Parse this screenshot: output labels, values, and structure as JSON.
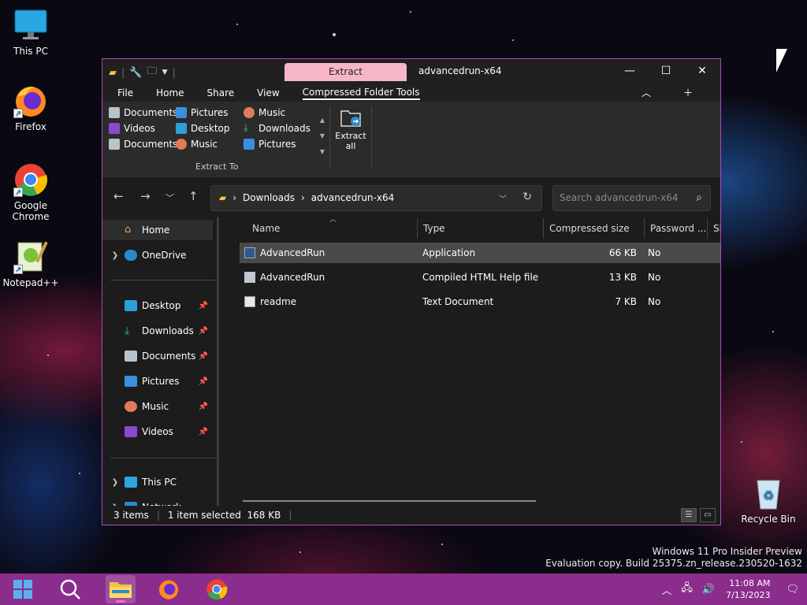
{
  "desktop": {
    "icons": [
      {
        "label": "This PC"
      },
      {
        "label": "Firefox"
      },
      {
        "label": "Google Chrome"
      },
      {
        "label": "Notepad++"
      },
      {
        "label": "Recycle Bin"
      }
    ]
  },
  "window": {
    "contextual_tab": "Extract",
    "title": "advancedrun-x64",
    "controls": {
      "minimize": "—",
      "maximize": "☐",
      "close": "✕"
    },
    "menu": [
      "File",
      "Home",
      "Share",
      "View",
      "Compressed Folder Tools"
    ],
    "ribbon": {
      "destinations": [
        "Documents",
        "Pictures",
        "Music",
        "Videos",
        "Desktop",
        "Downloads",
        "Documents",
        "Music",
        "Pictures"
      ],
      "group_label": "Extract To",
      "extract_all_line1": "Extract",
      "extract_all_line2": "all"
    },
    "address": {
      "segments": [
        "Downloads",
        "advancedrun-x64"
      ],
      "search_placeholder": "Search advancedrun-x64"
    },
    "sidebar": {
      "home": "Home",
      "onedrive": "OneDrive",
      "quick": [
        "Desktop",
        "Downloads",
        "Documents",
        "Pictures",
        "Music",
        "Videos"
      ],
      "thispc": "This PC",
      "network": "Network"
    },
    "columns": [
      "Name",
      "Type",
      "Compressed size",
      "Password ...",
      "Si"
    ],
    "files": [
      {
        "name": "AdvancedRun",
        "type": "Application",
        "size": "66 KB",
        "password": "No"
      },
      {
        "name": "AdvancedRun",
        "type": "Compiled HTML Help file",
        "size": "13 KB",
        "password": "No"
      },
      {
        "name": "readme",
        "type": "Text Document",
        "size": "7 KB",
        "password": "No"
      }
    ],
    "status": {
      "count": "3 items",
      "selection": "1 item selected  168 KB",
      "sep": "|"
    }
  },
  "watermark": {
    "line1": "Windows 11 Pro Insider Preview",
    "line2": "Evaluation copy. Build 25375.zn_release.230520-1632"
  },
  "taskbar": {
    "time": "11:08 AM",
    "date": "7/13/2023"
  },
  "colors": {
    "accent": "#b048b8",
    "taskbar": "#8a2d8c",
    "extract_tab": "#f7b6c8",
    "selection": "#4a4a4a"
  }
}
